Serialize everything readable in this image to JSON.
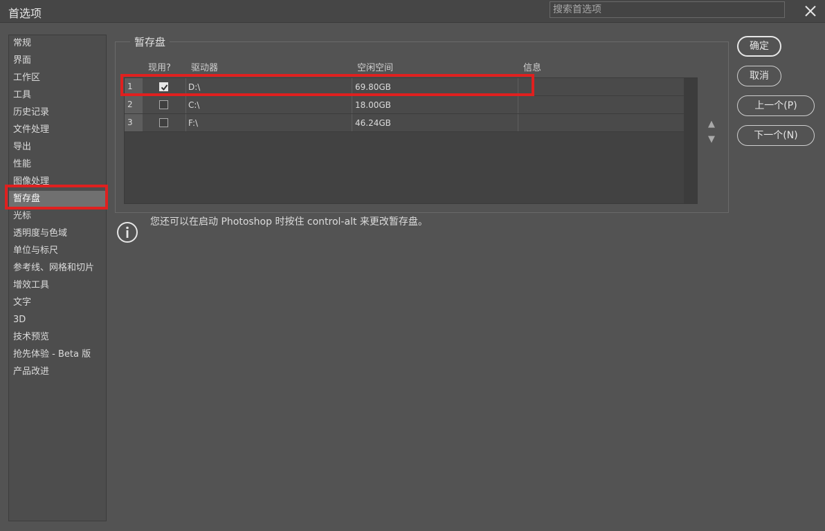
{
  "window": {
    "title": "首选项"
  },
  "search": {
    "placeholder": "搜索首选项"
  },
  "icons": {
    "close": "close-icon",
    "info": "info-icon",
    "checkmark": "checkmark-icon",
    "up": "arrow-up-icon",
    "down": "arrow-down-icon"
  },
  "sidebar": {
    "items": [
      {
        "label": "常规"
      },
      {
        "label": "界面"
      },
      {
        "label": "工作区"
      },
      {
        "label": "工具"
      },
      {
        "label": "历史记录"
      },
      {
        "label": "文件处理"
      },
      {
        "label": "导出"
      },
      {
        "label": "性能"
      },
      {
        "label": "图像处理"
      },
      {
        "label": "暂存盘"
      },
      {
        "label": "光标"
      },
      {
        "label": "透明度与色域"
      },
      {
        "label": "单位与标尺"
      },
      {
        "label": "参考线、网格和切片"
      },
      {
        "label": "增效工具"
      },
      {
        "label": "文字"
      },
      {
        "label": "3D"
      },
      {
        "label": "技术预览"
      },
      {
        "label": "抢先体验 - Beta 版"
      },
      {
        "label": "产品改进"
      }
    ],
    "selected": "暂存盘"
  },
  "scratch": {
    "title": "暂存盘",
    "columns": {
      "active": "现用?",
      "drive": "驱动器",
      "free": "空闲空间",
      "info": "信息"
    },
    "rows": [
      {
        "index": "1",
        "checked": true,
        "drive": "D:\\",
        "free": "69.80GB",
        "info": ""
      },
      {
        "index": "2",
        "checked": false,
        "drive": "C:\\",
        "free": "18.00GB",
        "info": ""
      },
      {
        "index": "3",
        "checked": false,
        "drive": "F:\\",
        "free": "46.24GB",
        "info": ""
      }
    ],
    "up_arrow": "▲",
    "down_arrow": "▼"
  },
  "buttons": {
    "ok": "确定",
    "cancel": "取消",
    "prev": "上一个(P)",
    "next": "下一个(N)"
  },
  "info": {
    "text": "您还可以在启动 Photoshop 时按住 control-alt 来更改暂存盘。"
  },
  "colors": {
    "highlight": "#e0201f",
    "background": "#535353"
  }
}
